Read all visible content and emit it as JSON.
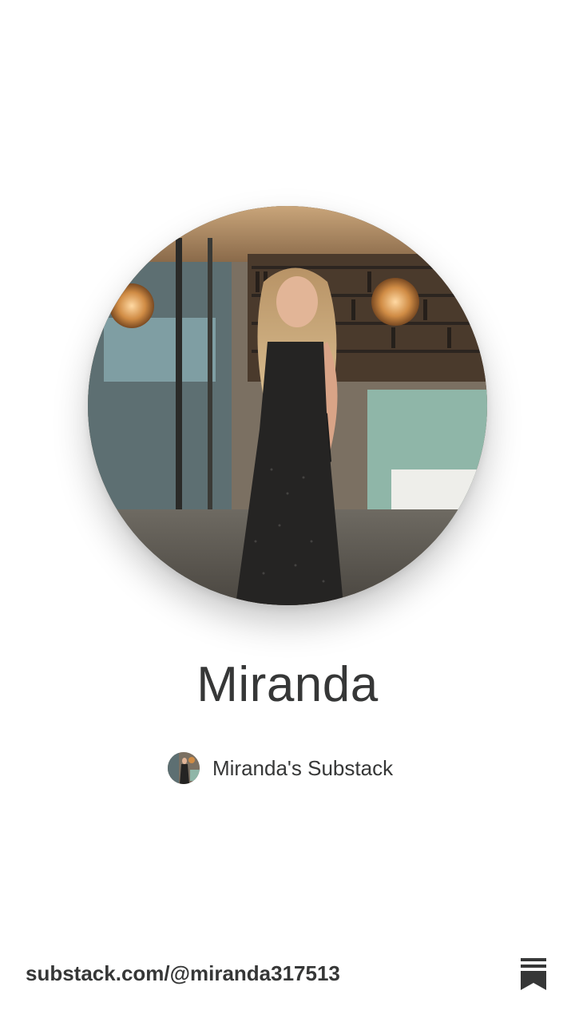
{
  "profile": {
    "name": "Miranda",
    "photo_icon": "profile-photo"
  },
  "publication": {
    "name": "Miranda's Substack",
    "icon": "publication-avatar"
  },
  "footer": {
    "url": "substack.com/@miranda317513",
    "logo_icon": "substack-logo-icon"
  },
  "colors": {
    "text": "#363737",
    "background": "#ffffff"
  }
}
